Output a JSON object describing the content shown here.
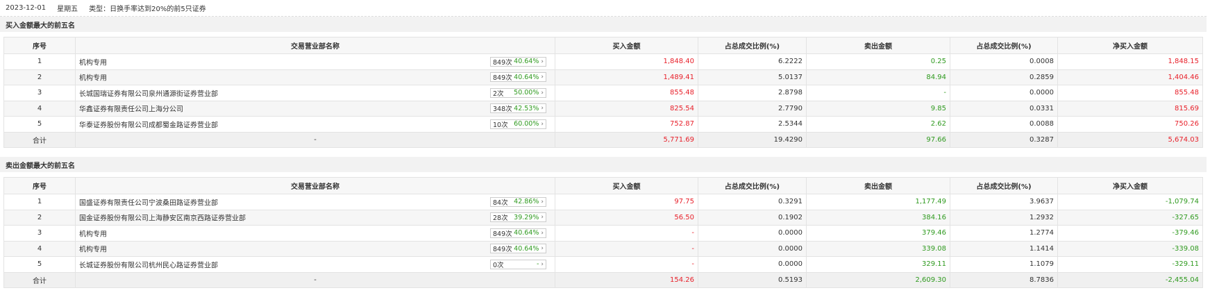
{
  "info": {
    "date": "2023-12-01",
    "weekday": "星期五",
    "type_label": "类型：",
    "type_value": "日换手率达到20%的前5只证券"
  },
  "buy": {
    "title": "买入金额最大的前五名",
    "headers": [
      "序号",
      "交易营业部名称",
      "买入金额",
      "占总成交比例(%)",
      "卖出金额",
      "占总成交比例(%)",
      "净买入金额"
    ],
    "rows": [
      {
        "idx": "1",
        "name": "机构专用",
        "count": "849次",
        "pct": "40.64%",
        "arrow": "›",
        "buy": "1,848.40",
        "buy_ratio": "6.2222",
        "sell": "0.25",
        "sell_ratio": "0.0008",
        "net": "1,848.15"
      },
      {
        "idx": "2",
        "name": "机构专用",
        "count": "849次",
        "pct": "40.64%",
        "arrow": "›",
        "buy": "1,489.41",
        "buy_ratio": "5.0137",
        "sell": "84.94",
        "sell_ratio": "0.2859",
        "net": "1,404.46"
      },
      {
        "idx": "3",
        "name": "长城国瑞证券有限公司泉州通源街证券营业部",
        "count": "2次",
        "pct": "50.00%",
        "arrow": "›",
        "buy": "855.48",
        "buy_ratio": "2.8798",
        "sell": "-",
        "sell_ratio": "0.0000",
        "net": "855.48"
      },
      {
        "idx": "4",
        "name": "华鑫证券有限责任公司上海分公司",
        "count": "348次",
        "pct": "42.53%",
        "arrow": "›",
        "buy": "825.54",
        "buy_ratio": "2.7790",
        "sell": "9.85",
        "sell_ratio": "0.0331",
        "net": "815.69"
      },
      {
        "idx": "5",
        "name": "华泰证券股份有限公司成都蜀金路证券营业部",
        "count": "10次",
        "pct": "60.00%",
        "arrow": "›",
        "buy": "752.87",
        "buy_ratio": "2.5344",
        "sell": "2.62",
        "sell_ratio": "0.0088",
        "net": "750.26"
      }
    ],
    "total": {
      "label": "合计",
      "name": "-",
      "buy": "5,771.69",
      "buy_ratio": "19.4290",
      "sell": "97.66",
      "sell_ratio": "0.3287",
      "net": "5,674.03"
    }
  },
  "sell": {
    "title": "卖出金额最大的前五名",
    "headers": [
      "序号",
      "交易营业部名称",
      "买入金额",
      "占总成交比例(%)",
      "卖出金额",
      "占总成交比例(%)",
      "净买入金额"
    ],
    "rows": [
      {
        "idx": "1",
        "name": "国盛证券有限责任公司宁波桑田路证券营业部",
        "count": "84次",
        "pct": "42.86%",
        "arrow": "›",
        "buy": "97.75",
        "buy_ratio": "0.3291",
        "sell": "1,177.49",
        "sell_ratio": "3.9637",
        "net": "-1,079.74"
      },
      {
        "idx": "2",
        "name": "国金证券股份有限公司上海静安区南京西路证券营业部",
        "count": "28次",
        "pct": "39.29%",
        "arrow": "›",
        "buy": "56.50",
        "buy_ratio": "0.1902",
        "sell": "384.16",
        "sell_ratio": "1.2932",
        "net": "-327.65"
      },
      {
        "idx": "3",
        "name": "机构专用",
        "count": "849次",
        "pct": "40.64%",
        "arrow": "›",
        "buy": "-",
        "buy_ratio": "0.0000",
        "sell": "379.46",
        "sell_ratio": "1.2774",
        "net": "-379.46"
      },
      {
        "idx": "4",
        "name": "机构专用",
        "count": "849次",
        "pct": "40.64%",
        "arrow": "›",
        "buy": "-",
        "buy_ratio": "0.0000",
        "sell": "339.08",
        "sell_ratio": "1.1414",
        "net": "-339.08"
      },
      {
        "idx": "5",
        "name": "长城证券股份有限公司杭州民心路证券营业部",
        "count": "0次",
        "pct": "-",
        "arrow": "›",
        "buy": "-",
        "buy_ratio": "0.0000",
        "sell": "329.11",
        "sell_ratio": "1.1079",
        "net": "-329.11"
      }
    ],
    "total": {
      "label": "合计",
      "name": "-",
      "buy": "154.26",
      "buy_ratio": "0.5193",
      "sell": "2,609.30",
      "sell_ratio": "8.7836",
      "net": "-2,455.04"
    }
  },
  "colors": {
    "positive": "#e8202a",
    "negative": "#2f9a1f"
  }
}
